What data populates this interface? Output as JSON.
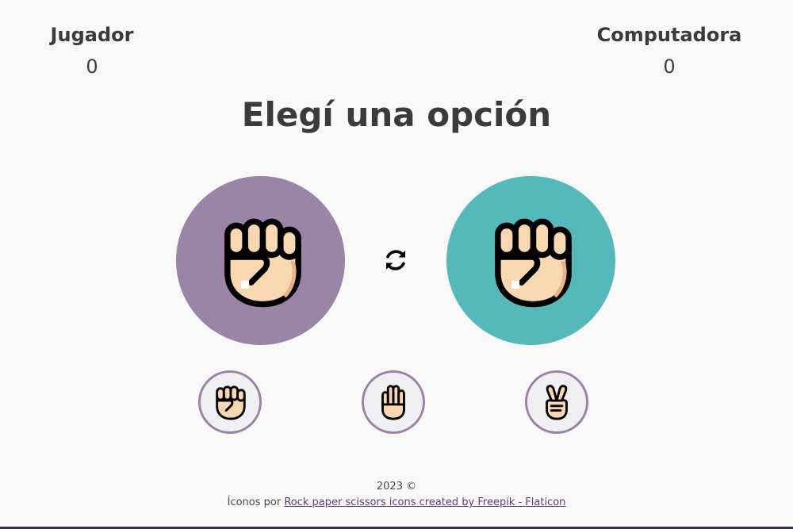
{
  "scoreboard": {
    "player_label": "Jugador",
    "player_score": "0",
    "computer_label": "Computadora",
    "computer_score": "0"
  },
  "title": "Elegí una opción",
  "board": {
    "player_hand_icon": "rock-fist-icon",
    "computer_hand_icon": "rock-fist-icon",
    "swap_icon": "refresh-icon"
  },
  "choices": [
    {
      "icon": "rock-fist-icon"
    },
    {
      "icon": "paper-hand-icon"
    },
    {
      "icon": "scissors-hand-icon"
    }
  ],
  "footer": {
    "copyright": "2023 ©",
    "credit_prefix": "Íconos por ",
    "credit_link": "Rock paper scissors icons created by Freepik - Flaticon"
  },
  "colors": {
    "player_circle": "#9a85a6",
    "computer_circle": "#55b8bb",
    "choice_border": "#9a85a6",
    "bottom_line": "#3a2f45"
  }
}
